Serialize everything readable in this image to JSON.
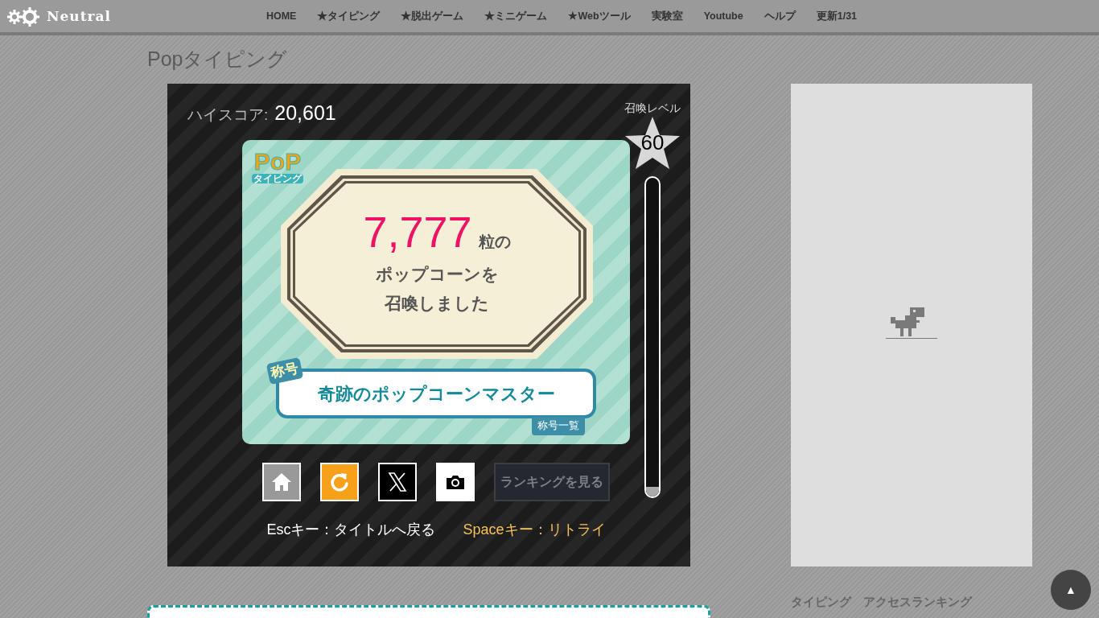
{
  "site": {
    "logo": "Neutral",
    "nav": [
      {
        "label": "HOME"
      },
      {
        "label": "★タイピング"
      },
      {
        "label": "★脱出ゲーム"
      },
      {
        "label": "★ミニゲーム"
      },
      {
        "label": "★Webツール"
      },
      {
        "label": "実験室"
      },
      {
        "label": "Youtube"
      },
      {
        "label": "ヘルプ"
      },
      {
        "label": "更新1/31"
      }
    ]
  },
  "page_title": "Popタイピング",
  "game": {
    "high_score_label": "ハイスコア:",
    "high_score": "20,601",
    "logo": {
      "top": "PoP",
      "bottom": "タイピング"
    },
    "count": "7,777",
    "count_suffix": "粒の",
    "message_lines": [
      "ポップコーンを",
      "召喚しました"
    ],
    "title_tag": "称号",
    "title": "奇跡のポップコーンマスター",
    "title_list_link": "称号一覧",
    "level_label": "召喚レベル",
    "level_value": "60",
    "meter": {
      "level": 0.03
    },
    "buttons": [
      {
        "kind": "home"
      },
      {
        "kind": "retry"
      },
      {
        "kind": "x"
      },
      {
        "kind": "camera"
      }
    ],
    "ranking_button": {
      "label": "ランキングを見る",
      "disabled": true
    },
    "hints": [
      {
        "text": "Escキー：タイトルへ戻る",
        "highlighted": false
      },
      {
        "text": "Spaceキー：リトライ",
        "highlighted": true
      }
    ]
  },
  "sidebar": {
    "ranking_heading": "タイピング　アクセスランキング"
  },
  "scroll_top": "▲"
}
